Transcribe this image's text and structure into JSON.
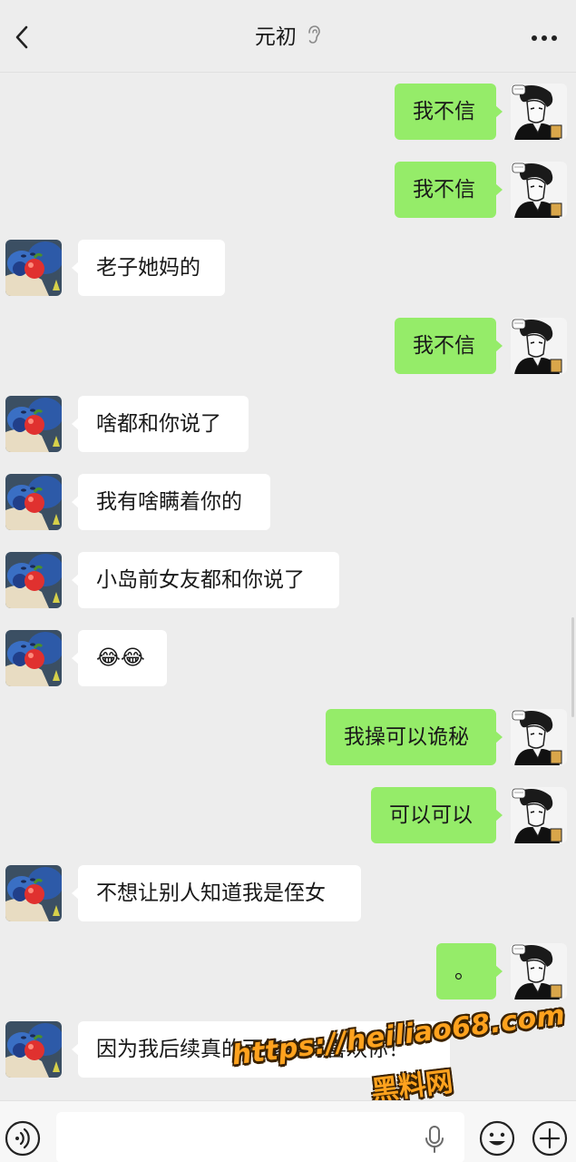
{
  "header": {
    "title": "元初",
    "back_icon": "chevron-left-icon",
    "muted_icon": "ear-icon",
    "more_icon": "ellipsis-icon"
  },
  "messages": [
    {
      "side": "out",
      "text": "我不信"
    },
    {
      "side": "out",
      "text": "我不信"
    },
    {
      "side": "in",
      "text": "老子她妈的"
    },
    {
      "side": "out",
      "text": "我不信"
    },
    {
      "side": "in",
      "text": "啥都和你说了"
    },
    {
      "side": "in",
      "text": "我有啥瞒着你的"
    },
    {
      "side": "in",
      "text": "小岛前女友都和你说了"
    },
    {
      "side": "in",
      "text": "😂😂"
    },
    {
      "side": "out",
      "text": "我操可以诡秘"
    },
    {
      "side": "out",
      "text": "可以可以"
    },
    {
      "side": "in",
      "text": "不想让别人知道我是侄女"
    },
    {
      "side": "out",
      "text": "。"
    },
    {
      "side": "in",
      "text": "因为我后续真的可能会有喜欢你！"
    }
  ],
  "composer": {
    "input_value": "",
    "voice_icon": "voice-mode-icon",
    "mic_icon": "microphone-icon",
    "emoji_icon": "emoji-icon",
    "plus_icon": "plus-icon"
  },
  "watermark": {
    "url": "https://heiliao68.com",
    "name": "黑料网"
  },
  "colors": {
    "background": "#ededed",
    "outgoing_bubble": "#95ec69",
    "incoming_bubble": "#ffffff",
    "watermark": "#ffa21e"
  }
}
